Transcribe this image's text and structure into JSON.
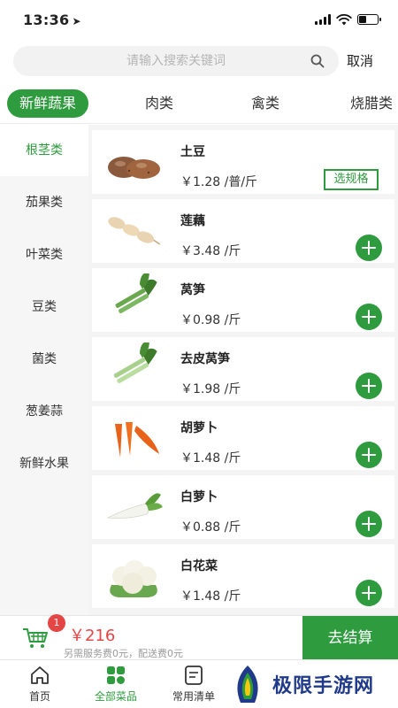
{
  "status": {
    "time": "13:36",
    "location_arrow": "➤"
  },
  "search": {
    "placeholder": "请输入搜索关键词",
    "value": "",
    "cancel_label": "取消"
  },
  "category_tabs": [
    {
      "label": "新鲜蔬果",
      "active": true
    },
    {
      "label": "肉类"
    },
    {
      "label": "禽类"
    },
    {
      "label": "烧腊类"
    }
  ],
  "sidebar": {
    "items": [
      {
        "label": "根茎类",
        "active": true
      },
      {
        "label": "茄果类"
      },
      {
        "label": "叶菜类"
      },
      {
        "label": "豆类"
      },
      {
        "label": "菌类"
      },
      {
        "label": "葱姜蒜"
      },
      {
        "label": "新鲜水果"
      }
    ]
  },
  "products": [
    {
      "name": "土豆",
      "price": "￥1.28 /普/斤",
      "action": "选规格",
      "image": "potato"
    },
    {
      "name": "莲藕",
      "price": "￥3.48 /斤",
      "image": "lotus-root"
    },
    {
      "name": "莴笋",
      "price": "￥0.98 /斤",
      "image": "celtuce"
    },
    {
      "name": "去皮莴笋",
      "price": "￥1.98 /斤",
      "image": "peeled-celtuce"
    },
    {
      "name": "胡萝卜",
      "price": "￥1.48 /斤",
      "image": "carrot"
    },
    {
      "name": "白萝卜",
      "price": "￥0.88 /斤",
      "image": "white-radish"
    },
    {
      "name": "白花菜",
      "price": "￥1.48 /斤",
      "image": "cauliflower"
    }
  ],
  "cart": {
    "badge_count": "1",
    "total": "￥216",
    "note": "另需服务费0元，配送费0元",
    "checkout_label": "去结算"
  },
  "bottom_nav": [
    {
      "label": "首页",
      "icon": "home-icon"
    },
    {
      "label": "全部菜品",
      "icon": "grid-icon",
      "active": true
    },
    {
      "label": "常用清单",
      "icon": "list-icon"
    }
  ],
  "watermark": {
    "text": "极限手游网"
  },
  "colors": {
    "accent": "#2e9c3e",
    "price_red": "#e64545",
    "watermark_blue": "#1f3a8a"
  }
}
